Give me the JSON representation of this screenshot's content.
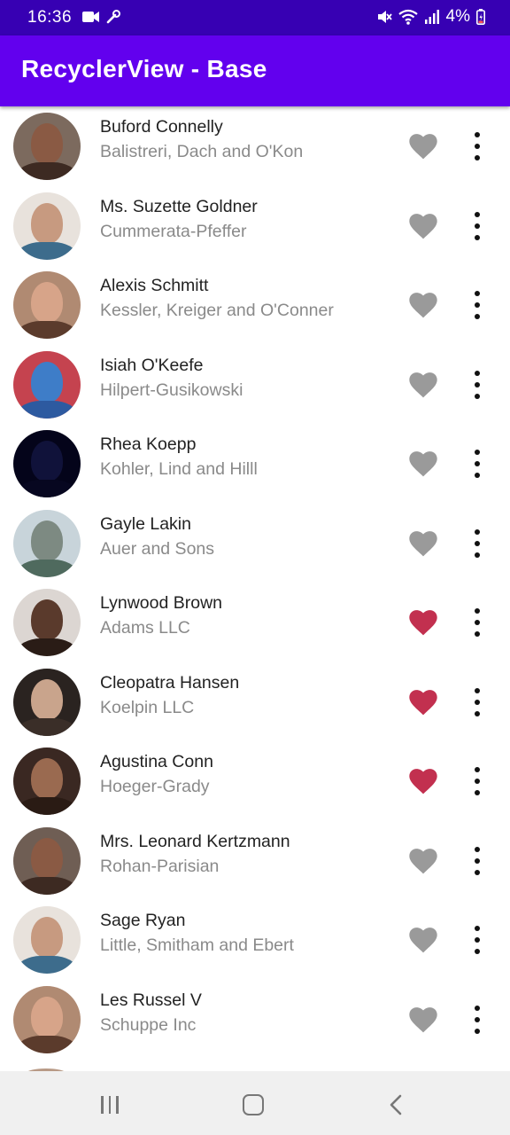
{
  "status_bar": {
    "time": "16:36",
    "battery": "4%",
    "icons": [
      "video-camera-icon",
      "wrench-icon",
      "mute-icon",
      "wifi-icon",
      "signal-icon",
      "battery-icon"
    ]
  },
  "app_bar": {
    "title": "RecyclerView - Base",
    "color": "#6200ee",
    "status_color": "#3700b3"
  },
  "colors": {
    "favorite_on": "#c2304f",
    "favorite_off": "#9a9a9a"
  },
  "contacts": [
    {
      "name": "Buford Connelly",
      "company": "Balistreri, Dach and O'Kon",
      "favorite": false
    },
    {
      "name": "Ms. Suzette Goldner",
      "company": "Cummerata-Pfeffer",
      "favorite": false
    },
    {
      "name": "Alexis Schmitt",
      "company": "Kessler, Kreiger and O'Conner",
      "favorite": false
    },
    {
      "name": "Isiah O'Keefe",
      "company": "Hilpert-Gusikowski",
      "favorite": false
    },
    {
      "name": "Rhea Koepp",
      "company": "Kohler, Lind and Hilll",
      "favorite": false
    },
    {
      "name": "Gayle Lakin",
      "company": "Auer and Sons",
      "favorite": false
    },
    {
      "name": "Lynwood Brown",
      "company": "Adams LLC",
      "favorite": true
    },
    {
      "name": "Cleopatra Hansen",
      "company": "Koelpin LLC",
      "favorite": true
    },
    {
      "name": "Agustina Conn",
      "company": "Hoeger-Grady",
      "favorite": true
    },
    {
      "name": "Mrs. Leonard Kertzmann",
      "company": "Rohan-Parisian",
      "favorite": false
    },
    {
      "name": "Sage Ryan",
      "company": "Little, Smitham and Ebert",
      "favorite": false
    },
    {
      "name": "Les Russel V",
      "company": "Schuppe Inc",
      "favorite": false
    }
  ],
  "navigation": {
    "icons": [
      "recents-icon",
      "home-icon",
      "back-icon"
    ]
  }
}
